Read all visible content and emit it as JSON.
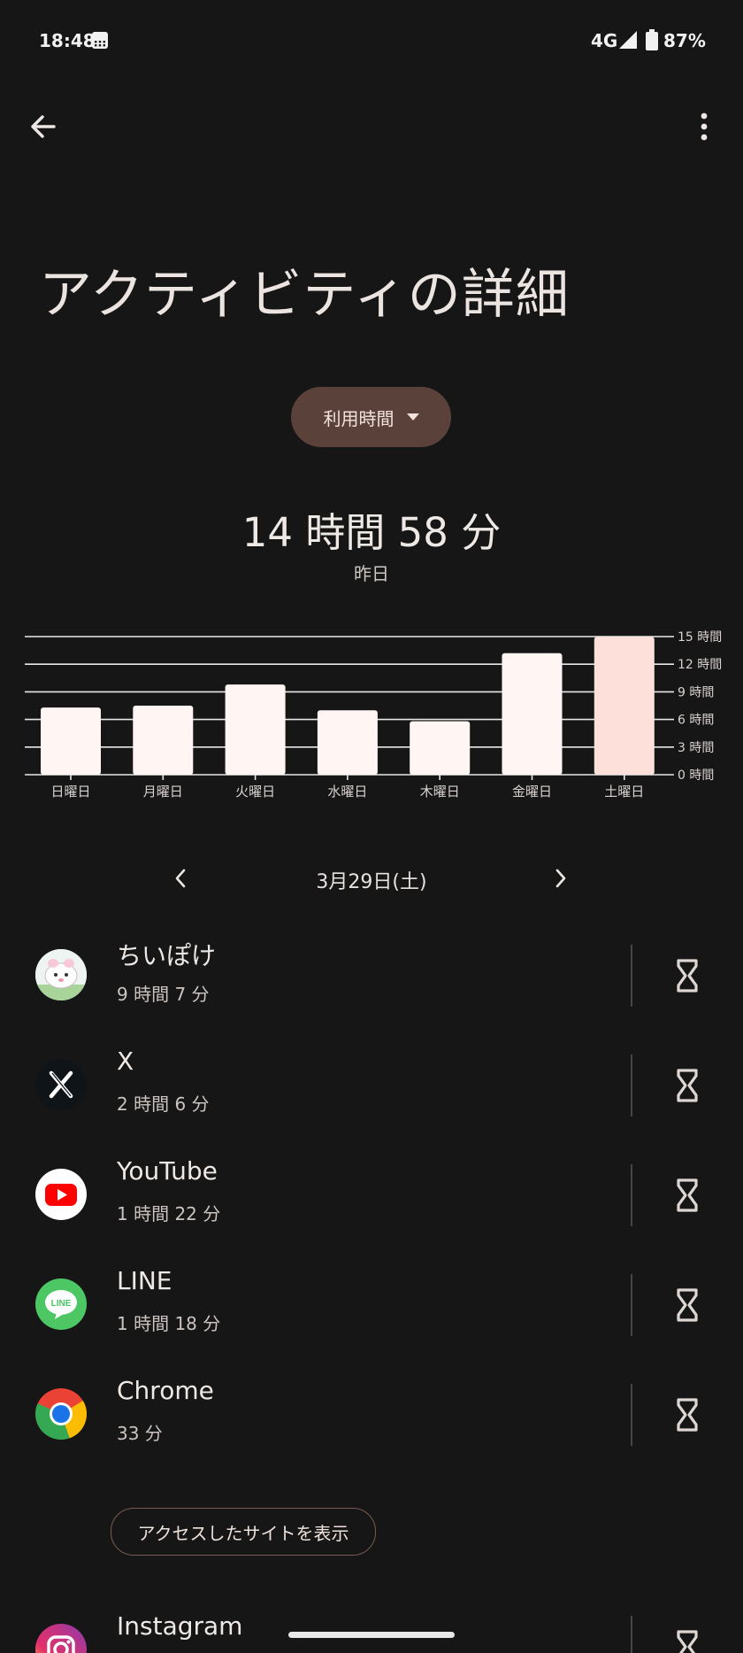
{
  "status_bar": {
    "time": "18:48",
    "network": "4G",
    "battery": "87%"
  },
  "page": {
    "title": "アクティビティの詳細",
    "dropdown_label": "利用時間",
    "total": "14 時間 58 分",
    "total_caption": "昨日"
  },
  "chart_data": {
    "type": "bar",
    "categories": [
      "日曜日",
      "月曜日",
      "火曜日",
      "水曜日",
      "木曜日",
      "金曜日",
      "土曜日"
    ],
    "values": [
      7.3,
      7.5,
      9.8,
      7.0,
      5.8,
      13.2,
      14.97
    ],
    "highlight_index": 6,
    "y_ticks": [
      "0 時間",
      "3 時間",
      "6 時間",
      "9 時間",
      "12 時間",
      "15 時間"
    ],
    "ylim": [
      0,
      15
    ],
    "colors": {
      "bar": "#fff6f4",
      "highlight": "#fde0da",
      "grid": "#e8e8e8"
    }
  },
  "date_nav": {
    "label": "3月29日(土)"
  },
  "apps": [
    {
      "name": "ちいぽけ",
      "time": "9 時間 7 分",
      "icon": "chiipoke-icon"
    },
    {
      "name": "X",
      "time": "2 時間 6 分",
      "icon": "x-icon"
    },
    {
      "name": "YouTube",
      "time": "1 時間 22 分",
      "icon": "youtube-icon"
    },
    {
      "name": "LINE",
      "time": "1 時間 18 分",
      "icon": "line-icon"
    },
    {
      "name": "Chrome",
      "time": "33 分",
      "icon": "chrome-icon"
    }
  ],
  "sites_button": "アクセスしたサイトを表示",
  "apps_more": [
    {
      "name": "Instagram",
      "icon": "instagram-icon"
    }
  ],
  "icons": {
    "line_badge": "LINE"
  }
}
